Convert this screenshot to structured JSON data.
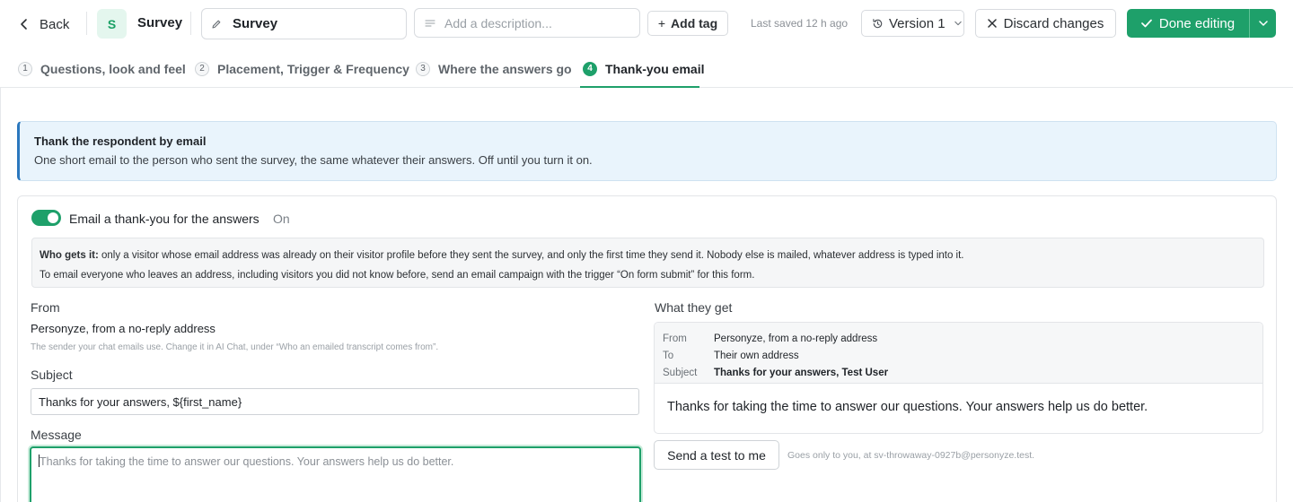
{
  "header": {
    "back_label": "Back",
    "avatar_letter": "S",
    "app_name": "Survey",
    "name_value": "Survey",
    "description_placeholder": "Add a description...",
    "add_tag_label": "Add tag",
    "last_saved": "Last saved 12 h ago",
    "version_label": "Version 1",
    "discard_label": "Discard changes",
    "done_label": "Done editing"
  },
  "tabs": [
    {
      "num": "1",
      "label": "Questions, look and feel",
      "active": false
    },
    {
      "num": "2",
      "label": "Placement, Trigger & Frequency",
      "active": false
    },
    {
      "num": "3",
      "label": "Where the answers go",
      "active": false
    },
    {
      "num": "4",
      "label": "Thank-you email",
      "active": true
    }
  ],
  "callout": {
    "title": "Thank the respondent by email",
    "text": "One short email to the person who sent the survey, the same whatever their answers. Off until you turn it on."
  },
  "toggle": {
    "label": "Email a thank-you for the answers",
    "state": "On"
  },
  "note": {
    "lead": "Who gets it:",
    "line1": " only a visitor whose email address was already on their visitor profile before they sent the survey, and only the first time they send it. Nobody else is mailed, whatever address is typed into it.",
    "line2": "To email everyone who leaves an address, including visitors you did not know before, send an email campaign with the trigger “On form submit” for this form."
  },
  "form": {
    "from_label": "From",
    "from_value": "Personyze, from a no-reply address",
    "from_hint": "The sender your chat emails use. Change it in AI Chat, under “Who an emailed transcript comes from”.",
    "subject_label": "Subject",
    "subject_value": "Thanks for your answers, ${first_name}",
    "message_label": "Message",
    "message_value": "Thanks for taking the time to answer our questions. Your answers help us do better."
  },
  "preview": {
    "title": "What they get",
    "from_key": "From",
    "from_val": "Personyze, from a no-reply address",
    "to_key": "To",
    "to_val": "Their own address",
    "subject_key": "Subject",
    "subject_val": "Thanks for your answers, Test User",
    "body": "Thanks for taking the time to answer our questions. Your answers help us do better.",
    "test_button": "Send a test to me",
    "test_hint": "Goes only to you, at sv-throwaway-0927b@personyze.test."
  },
  "colors": {
    "accent": "#1ea06a",
    "callout_border": "#2b78be",
    "callout_bg": "#e9f4fc"
  }
}
